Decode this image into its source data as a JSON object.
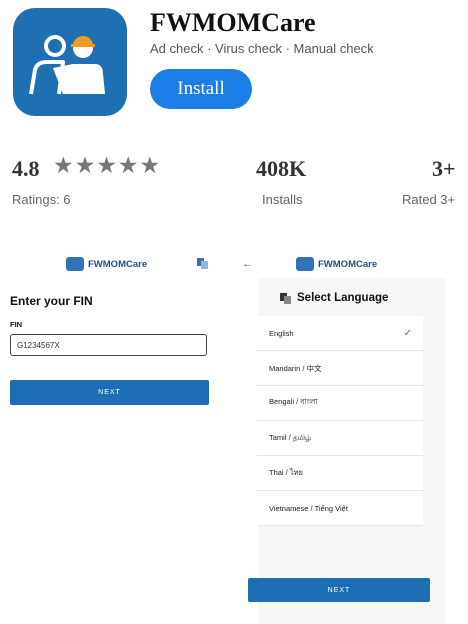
{
  "app": {
    "name": "FWMOMCare",
    "subtitle": "Ad check · Virus check · Manual check",
    "install_label": "Install",
    "brand_color": "#1f6fb3"
  },
  "stats": {
    "rating_value": "4.8",
    "rating_stars": "★★★★★",
    "rating_label": "Ratings: 6",
    "installs_value": "408K",
    "installs_label": "Installs",
    "age_value": "3+",
    "age_label": "Rated 3+"
  },
  "screen1": {
    "brand": "FWMOMCare",
    "title": "Enter your FIN",
    "field_label": "FIN",
    "field_value": "G1234567X",
    "next_label": "NEXT"
  },
  "screen2": {
    "brand": "FWMOMCare",
    "title": "Select Language",
    "next_label": "NEXT",
    "languages": [
      "English",
      "Mandarin / 中文",
      "Bengali / বাংলা",
      "Tamil / தமிழ்",
      "Thai / ไทย",
      "Vietnamese / Tiếng Việt"
    ],
    "selected": "English"
  }
}
